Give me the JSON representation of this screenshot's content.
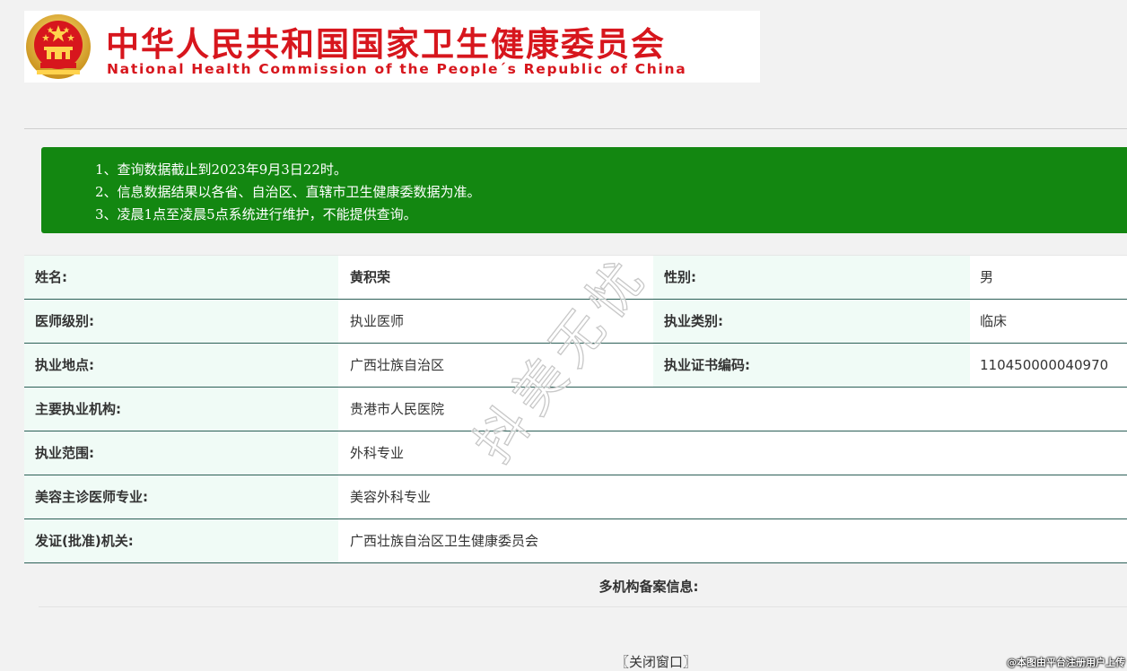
{
  "header": {
    "title_cn": "中华人民共和国国家卫生健康委员会",
    "title_en": "National Health Commission of the People´s Republic of China",
    "emblem_icon": "national-emblem-icon",
    "brand_color": "#d7161d"
  },
  "notice": {
    "background_color": "#138711",
    "lines": [
      "1、查询数据截止到2023年9月3日22时。",
      "2、信息数据结果以各省、自治区、直辖市卫生健康委数据为准。",
      "3、凌晨1点至凌晨5点系统进行维护，不能提供查询。"
    ]
  },
  "info": {
    "name_label": "姓名:",
    "name_value": "黄积荣",
    "gender_label": "性别:",
    "gender_value": "男",
    "level_label": "医师级别:",
    "level_value": "执业医师",
    "category_label": "执业类别:",
    "category_value": "临床",
    "location_label": "执业地点:",
    "location_value": "广西壮族自治区",
    "cert_label": "执业证书编码:",
    "cert_value": "110450000040970",
    "institution_label": "主要执业机构:",
    "institution_value": "贵港市人民医院",
    "scope_label": "执业范围:",
    "scope_value": "外科专业",
    "cosmetic_label": "美容主诊医师专业:",
    "cosmetic_value": "美容外科专业",
    "issuer_label": "发证(批准)机关:",
    "issuer_value": "广西壮族自治区卫生健康委员会"
  },
  "multi": {
    "title": "多机构备案信息:"
  },
  "close_link": "〖关闭窗口〗",
  "watermark": "抖美无忧",
  "corner_mark": "@本图由平台注册用户上传"
}
